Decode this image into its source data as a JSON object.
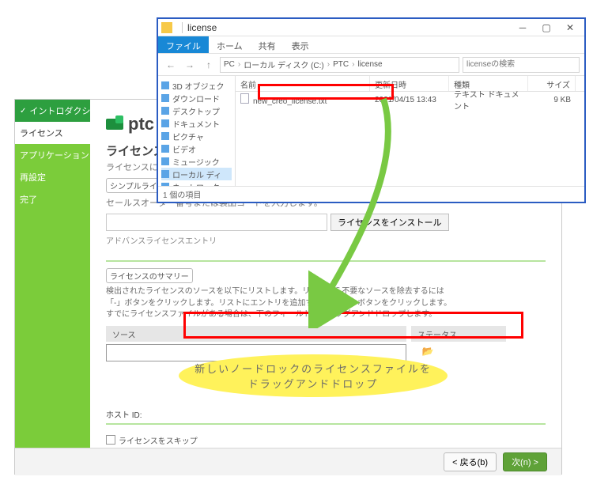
{
  "installer": {
    "logo_text": "ptc",
    "sidebar": {
      "items": [
        {
          "label": "イントロダクション"
        },
        {
          "label": "ライセンス"
        },
        {
          "label": "アプリケーション"
        },
        {
          "label": "再設定"
        },
        {
          "label": "完了"
        }
      ]
    },
    "license_title": "ライセンス ID",
    "license_sub": "ライセンスに基づいて、マシ…",
    "simple_tab": "シンプルライセンスエ",
    "sales_label": "セールスオーダー番号または製品コードを入力します。",
    "install_btn": "ライセンスをインストール",
    "adv_link": "アドバンスライセンスエントリ",
    "summary_title": "ライセンスのサマリー",
    "summary_note1": "検出されたライセンスのソースを以下にリストします。リストから不要なソースを除去するには",
    "summary_note2": "「-」ボタンをクリックします。リストにエントリを追加するには「+」ボタンをクリックします。",
    "summary_note3": "すでにライセンスファイルがある場合は、下のフィールドにドラッグアンドドロップします。",
    "col_source": "ソース",
    "col_status": "ステータス",
    "host_label": "ホスト ID:",
    "skip_label": "ライセンスをスキップ",
    "back_btn": "< 戻る(b)",
    "next_btn": "次(n) >"
  },
  "explorer": {
    "title": "license",
    "ribbon": {
      "file": "ファイル",
      "home": "ホーム",
      "share": "共有",
      "view": "表示"
    },
    "breadcrumb": [
      "PC",
      "ローカル ディスク (C:)",
      "PTC",
      "license"
    ],
    "search_placeholder": "licenseの検索",
    "nav": [
      "3D オブジェク",
      "ダウンロード",
      "デスクトップ",
      "ドキュメント",
      "ピクチャ",
      "ビデオ",
      "ミュージック",
      "ローカル ディ",
      "ネットワーク"
    ],
    "columns": {
      "name": "名前",
      "date": "更新日時",
      "type": "種類",
      "size": "サイズ"
    },
    "file": {
      "name": "new_creo_license.txt",
      "date": "2021/04/15 13:43",
      "type": "テキスト ドキュメント",
      "size": "9 KB"
    },
    "status": "1 個の項目"
  },
  "callout": {
    "line1": "新しいノードロックのライセンスファイルを",
    "line2": "ドラッグアンドドロップ"
  }
}
